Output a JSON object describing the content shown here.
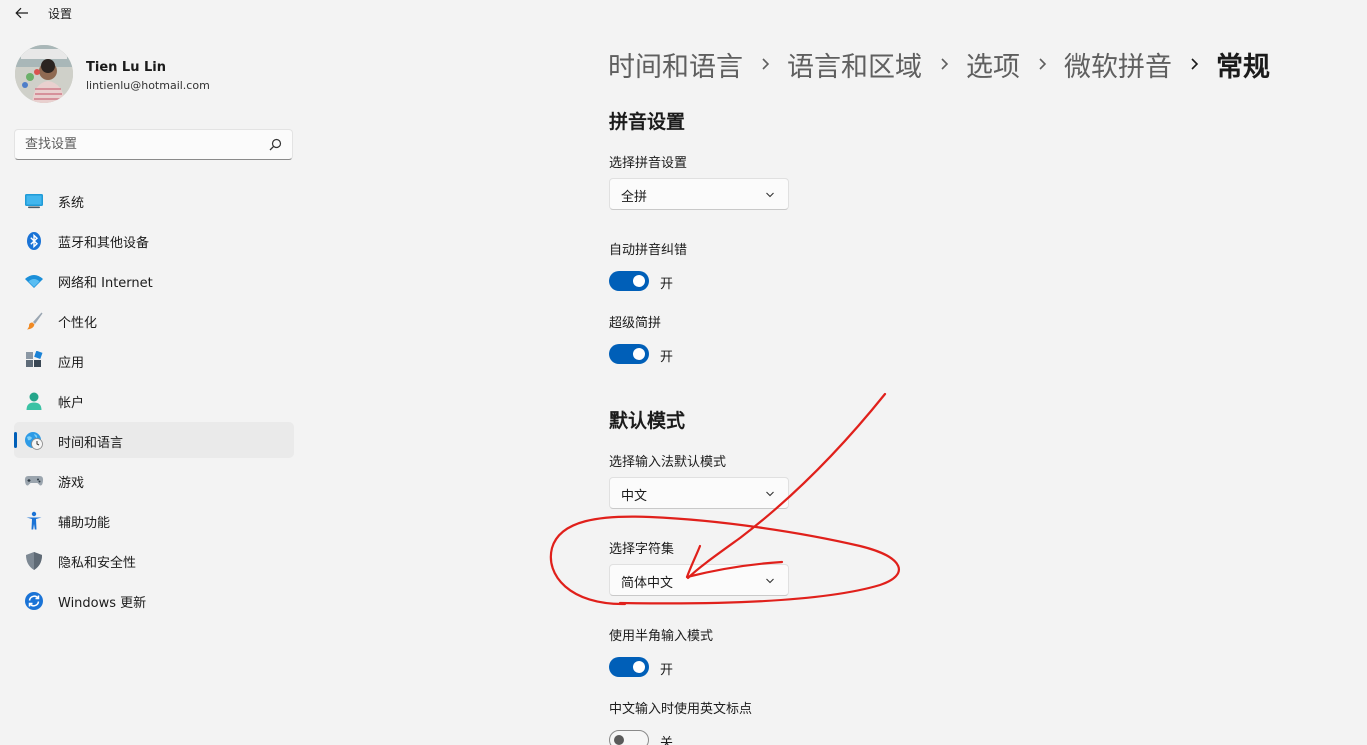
{
  "window": {
    "title": "设置",
    "back_icon": "back-arrow-icon"
  },
  "profile": {
    "name": "Tien Lu Lin",
    "email": "lintienlu@hotmail.com"
  },
  "search": {
    "placeholder": "查找设置",
    "value": "",
    "icon": "search-icon"
  },
  "sidebar": {
    "items": [
      {
        "label": "系统",
        "icon": "monitor-icon",
        "active": false
      },
      {
        "label": "蓝牙和其他设备",
        "icon": "bluetooth-icon",
        "active": false
      },
      {
        "label": "网络和 Internet",
        "icon": "wifi-icon",
        "active": false
      },
      {
        "label": "个性化",
        "icon": "paintbrush-icon",
        "active": false
      },
      {
        "label": "应用",
        "icon": "apps-icon",
        "active": false
      },
      {
        "label": "帐户",
        "icon": "person-icon",
        "active": false
      },
      {
        "label": "时间和语言",
        "icon": "globe-clock-icon",
        "active": true
      },
      {
        "label": "游戏",
        "icon": "gamepad-icon",
        "active": false
      },
      {
        "label": "辅助功能",
        "icon": "accessibility-icon",
        "active": false
      },
      {
        "label": "隐私和安全性",
        "icon": "shield-icon",
        "active": false
      },
      {
        "label": "Windows 更新",
        "icon": "update-icon",
        "active": false
      }
    ]
  },
  "breadcrumb": {
    "items": [
      "时间和语言",
      "语言和区域",
      "选项",
      "微软拼音"
    ],
    "current": "常规"
  },
  "content": {
    "pinyin_section": {
      "title": "拼音设置",
      "pinyin_setting": {
        "label": "选择拼音设置",
        "value": "全拼"
      },
      "auto_correct": {
        "label": "自动拼音纠错",
        "state": "开",
        "on": true
      },
      "super_abbrev": {
        "label": "超级简拼",
        "state": "开",
        "on": true
      }
    },
    "default_mode_section": {
      "title": "默认模式",
      "ime_mode": {
        "label": "选择输入法默认模式",
        "value": "中文"
      },
      "charset": {
        "label": "选择字符集",
        "value": "简体中文"
      },
      "half_width": {
        "label": "使用半角输入模式",
        "state": "开",
        "on": true
      },
      "english_punct": {
        "label": "中文输入时使用英文标点",
        "state": "关",
        "on": false
      }
    }
  },
  "colors": {
    "accent": "#005fb8",
    "background": "#f3f3f3",
    "annotation_red": "#e0201b"
  }
}
